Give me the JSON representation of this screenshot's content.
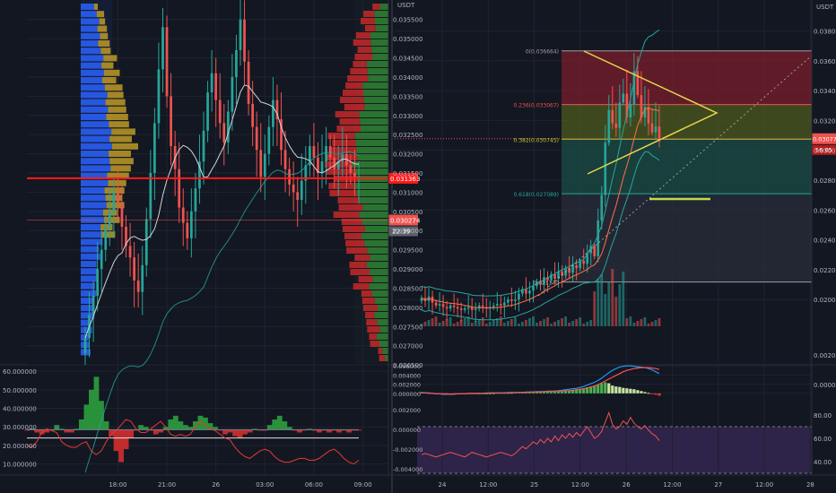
{
  "colors": {
    "background": "#131722",
    "grid": "#1e2330",
    "text": "#b2b5be",
    "up": "#26a69a",
    "down": "#ef5350",
    "price_line": "#ff1a1a",
    "vp_blue": "#2962ff",
    "vp_gold": "#c9a227",
    "vp_green": "#2e7d32",
    "vp_red": "#c62828",
    "fib_red": "#7a1f2b",
    "fib_olive": "#4d5a1e",
    "fib_teal": "#1b4d45",
    "fib_gray": "#2a2e39",
    "triangle": "#e8d44d",
    "rsi_band": "#3b2a5a"
  },
  "chart_data": [
    {
      "type": "candlestick",
      "name_key": "left-price",
      "x_tick_labels": [
        "18:00",
        "21:00",
        "26",
        "03:00",
        "06:00",
        "09:00"
      ],
      "x_tick_index": [
        8,
        20,
        32,
        44,
        56,
        68
      ],
      "y_tick_labels": [
        "0.035500",
        "0.035000",
        "0.034500",
        "0.034000",
        "0.033500",
        "0.033000",
        "0.032500",
        "0.032000",
        "0.031500",
        "0.031000",
        "0.030500",
        "0.030000",
        "0.029500",
        "0.029000",
        "0.028500",
        "0.028000",
        "0.027500",
        "0.027000",
        "0.026500"
      ],
      "y_tick_values": [
        0.0355,
        0.035,
        0.0345,
        0.034,
        0.0335,
        0.033,
        0.0325,
        0.032,
        0.0315,
        0.031,
        0.0305,
        0.03,
        0.0295,
        0.029,
        0.0285,
        0.028,
        0.0275,
        0.027,
        0.0265
      ],
      "ylim": [
        0.02655,
        0.03596
      ],
      "unit": "USDT",
      "current_price_label": "0.031363",
      "current_price": 0.031363,
      "badge2_label": "0.030274",
      "badge2_value": 0.030274,
      "badge3_label": "22:39",
      "close": [
        0.0272,
        0.0278,
        0.0283,
        0.029,
        0.0295,
        0.0301,
        0.0305,
        0.031,
        0.0307,
        0.0301,
        0.0296,
        0.0293,
        0.0287,
        0.0284,
        0.0291,
        0.0303,
        0.0315,
        0.0328,
        0.0342,
        0.0353,
        0.0335,
        0.0322,
        0.0316,
        0.0306,
        0.0302,
        0.0298,
        0.0305,
        0.0311,
        0.0318,
        0.0326,
        0.0336,
        0.0341,
        0.0334,
        0.0328,
        0.0323,
        0.0331,
        0.034,
        0.0347,
        0.0355,
        0.0344,
        0.0333,
        0.0327,
        0.0321,
        0.0314,
        0.032,
        0.0327,
        0.0334,
        0.0329,
        0.0321,
        0.0316,
        0.0312,
        0.031,
        0.0308,
        0.0313,
        0.0317,
        0.0322,
        0.0319,
        0.0315,
        0.0318,
        0.0322,
        0.0319,
        0.0316,
        0.0318,
        0.032,
        0.0317,
        0.0315,
        0.0314,
        0.0314
      ]
    },
    {
      "type": "area",
      "name_key": "left-oscillator",
      "y_tick_labels": [
        "60.000000",
        "50.000000",
        "40.000000",
        "30.000000",
        "20.000000",
        "10.000000"
      ],
      "y_tick_values": [
        60,
        50,
        40,
        30,
        20,
        10
      ],
      "ylim": [
        5,
        62
      ],
      "baseline": 28.5,
      "reference_line": 24,
      "series_up_down": [
        28,
        29,
        27,
        26,
        27,
        28,
        31,
        29,
        27,
        27,
        29,
        34,
        42,
        50,
        57,
        44,
        33,
        25,
        17,
        11,
        18,
        24,
        28,
        31,
        30,
        28,
        26,
        27,
        30,
        34,
        36,
        33,
        31,
        30,
        33,
        36,
        35,
        32,
        30,
        28,
        26,
        27,
        25,
        24,
        26,
        27,
        29,
        28,
        28,
        31,
        34,
        36,
        33,
        30,
        28,
        27,
        28,
        29,
        28,
        27,
        28,
        27,
        28,
        27,
        28,
        27,
        28,
        28
      ],
      "series_red": [
        20,
        19,
        22,
        27,
        29,
        28,
        27,
        22,
        20,
        19,
        19,
        21,
        22,
        17,
        15,
        17,
        22,
        26,
        28,
        31,
        34,
        33,
        29,
        27,
        27,
        29,
        31,
        33,
        30,
        26,
        25,
        26,
        25,
        26,
        30,
        33,
        31,
        29,
        28,
        26,
        24,
        23,
        19,
        16,
        14,
        13,
        15,
        17,
        18,
        17,
        14,
        12,
        11,
        11,
        12,
        13,
        13,
        12,
        12,
        13,
        15,
        17,
        18,
        16,
        13,
        11,
        10,
        12
      ]
    },
    {
      "type": "candlestick",
      "name_key": "right-price",
      "unit": "USDT",
      "x_tick_labels": [
        "24",
        "12:00",
        "25",
        "12:00",
        "26",
        "12:00",
        "27",
        "12:00",
        "28"
      ],
      "x_tick_index": [
        6,
        22,
        38,
        54,
        70,
        86,
        102,
        118,
        134
      ],
      "y_tick_labels": [
        "0.038000",
        "0.036000",
        "0.034000",
        "0.032000",
        "0.030000",
        "0.028000",
        "0.026000",
        "0.024000",
        "0.022000",
        "0.020000"
      ],
      "y_tick_values": [
        0.038,
        0.036,
        0.034,
        0.032,
        0.03,
        0.028,
        0.026,
        0.024,
        0.022,
        0.02
      ],
      "ylim": [
        0.01815,
        0.03995
      ],
      "current_price_label": "0.030777",
      "current_price": 0.030777,
      "badge2_label": "56:05",
      "fib_levels": [
        {
          "label": "0(0.036664)",
          "value": 0.036664
        },
        {
          "label": "0.236(0.033067)",
          "value": 0.033067
        },
        {
          "label": "0.382(0.030745)",
          "value": 0.030745
        },
        {
          "label": "0.618(0.027089)",
          "value": 0.027089
        }
      ],
      "fib_low": 0.021176,
      "low_label": "0.021170",
      "close": [
        0.0201,
        0.0199,
        0.0202,
        0.0198,
        0.0196,
        0.0197,
        0.0195,
        0.0194,
        0.0196,
        0.0195,
        0.0194,
        0.0193,
        0.0194,
        0.0195,
        0.0193,
        0.0194,
        0.0196,
        0.0195,
        0.0194,
        0.0195,
        0.0196,
        0.0197,
        0.0196,
        0.0198,
        0.02,
        0.0199,
        0.02,
        0.0204,
        0.0207,
        0.0204,
        0.0206,
        0.0209,
        0.0212,
        0.021,
        0.0215,
        0.0213,
        0.0217,
        0.0214,
        0.0219,
        0.0216,
        0.0221,
        0.0218,
        0.0223,
        0.0221,
        0.0226,
        0.0224,
        0.0231,
        0.0236,
        0.0229,
        0.0253,
        0.027,
        0.0305,
        0.0327,
        0.0318,
        0.0315,
        0.0332,
        0.0338,
        0.0322,
        0.0331,
        0.0353,
        0.0337,
        0.0322,
        0.0329,
        0.0318,
        0.0312,
        0.0316,
        0.0308
      ]
    },
    {
      "type": "histogram",
      "name_key": "right-macd",
      "y_tick_labels": [
        "0.006000",
        "0.004000",
        "0.002000",
        "0.000000"
      ],
      "y_tick_values": [
        0.006,
        0.004,
        0.002,
        0
      ],
      "right_y_tick_labels": [
        "0.002000",
        "0.000000"
      ],
      "right_y_tick_values": [
        0.002,
        0
      ],
      "ylim": [
        -0.0012,
        0.0066
      ],
      "histogram": [
        0.0003,
        0.0002,
        0.0002,
        0.0001,
        0.0,
        -0.0001,
        -0.0001,
        -0.0002,
        -0.0002,
        -0.0002,
        -0.0002,
        -0.0002,
        -0.0001,
        -0.0001,
        -0.0001,
        -0.0001,
        0.0,
        0.0,
        0.0,
        0.0,
        0.0,
        0.0001,
        0.0001,
        0.0001,
        0.0001,
        0.0001,
        0.0002,
        0.0002,
        0.0002,
        0.0002,
        0.0002,
        0.0002,
        0.0003,
        0.0003,
        0.0003,
        0.0003,
        0.0003,
        0.0004,
        0.0004,
        0.0004,
        0.0005,
        0.0006,
        0.0007,
        0.0008,
        0.0009,
        0.0011,
        0.0013,
        0.0015,
        0.0017,
        0.0019,
        0.0022,
        0.0024,
        0.0022,
        0.0017,
        0.0015,
        0.0014,
        0.0012,
        0.0011,
        0.001,
        0.0009,
        0.0007,
        0.0005,
        0.0003,
        0.0001,
        -0.0001,
        -0.0003,
        -0.0005
      ],
      "macd": [
        0.0002,
        0.0001,
        0.0001,
        0.0,
        -0.0001,
        -0.0001,
        -0.0002,
        -0.0002,
        -0.0002,
        -0.0002,
        -0.0001,
        -0.0001,
        -0.0001,
        0.0,
        0.0,
        0.0,
        0.0,
        0.0,
        0.0001,
        0.0001,
        0.0001,
        0.0001,
        0.0001,
        0.0001,
        0.0002,
        0.0002,
        0.0002,
        0.0002,
        0.0002,
        0.0003,
        0.0003,
        0.0003,
        0.0004,
        0.0004,
        0.0004,
        0.0005,
        0.0005,
        0.0005,
        0.0006,
        0.0007,
        0.0008,
        0.0009,
        0.001,
        0.0011,
        0.0013,
        0.0015,
        0.0018,
        0.0021,
        0.0024,
        0.0028,
        0.0033,
        0.0039,
        0.0045,
        0.005,
        0.0054,
        0.0057,
        0.0059,
        0.006,
        0.006,
        0.0059,
        0.0058,
        0.0057,
        0.0056,
        0.0054,
        0.0051,
        0.0047,
        0.0043
      ],
      "signal": [
        0.0001,
        0.0001,
        0.0,
        0.0,
        -0.0001,
        -0.0001,
        -0.0001,
        -0.0001,
        -0.0002,
        -0.0001,
        -0.0001,
        -0.0001,
        -0.0001,
        0.0,
        0.0,
        0.0,
        0.0,
        0.0,
        0.0,
        0.0001,
        0.0001,
        0.0001,
        0.0001,
        0.0001,
        0.0001,
        0.0001,
        0.0002,
        0.0002,
        0.0002,
        0.0002,
        0.0003,
        0.0003,
        0.0003,
        0.0003,
        0.0004,
        0.0004,
        0.0004,
        0.0005,
        0.0005,
        0.0005,
        0.0006,
        0.0006,
        0.0007,
        0.0008,
        0.0009,
        0.001,
        0.0012,
        0.0014,
        0.0016,
        0.0019,
        0.0023,
        0.0027,
        0.0031,
        0.0035,
        0.0039,
        0.0043,
        0.0047,
        0.005,
        0.0052,
        0.0054,
        0.0055,
        0.0056,
        0.0056,
        0.0056,
        0.0055,
        0.0054,
        0.0052
      ]
    },
    {
      "type": "line",
      "name_key": "right-rsi",
      "left_y_tick_labels": [
        "0.002000",
        "0.000000",
        "-0.002000",
        "-0.004000"
      ],
      "left_y_tick_values": [
        0.002,
        0.0,
        -0.002,
        -0.004
      ],
      "y_tick_labels": [
        "80.00",
        "60.00",
        "40.00"
      ],
      "y_tick_values": [
        80,
        60,
        40
      ],
      "ylim": [
        30,
        90
      ],
      "band": [
        30,
        70
      ],
      "values": [
        46,
        47,
        46,
        45,
        44,
        45,
        46,
        47,
        48,
        47,
        46,
        45,
        44,
        46,
        48,
        47,
        46,
        45,
        44,
        45,
        46,
        47,
        48,
        47,
        46,
        45,
        47,
        50,
        53,
        51,
        54,
        57,
        55,
        59,
        56,
        60,
        57,
        62,
        58,
        63,
        60,
        64,
        61,
        65,
        62,
        66,
        70,
        65,
        60,
        62,
        66,
        74,
        82,
        72,
        68,
        70,
        75,
        72,
        78,
        73,
        70,
        68,
        71,
        67,
        64,
        62,
        58
      ]
    }
  ]
}
